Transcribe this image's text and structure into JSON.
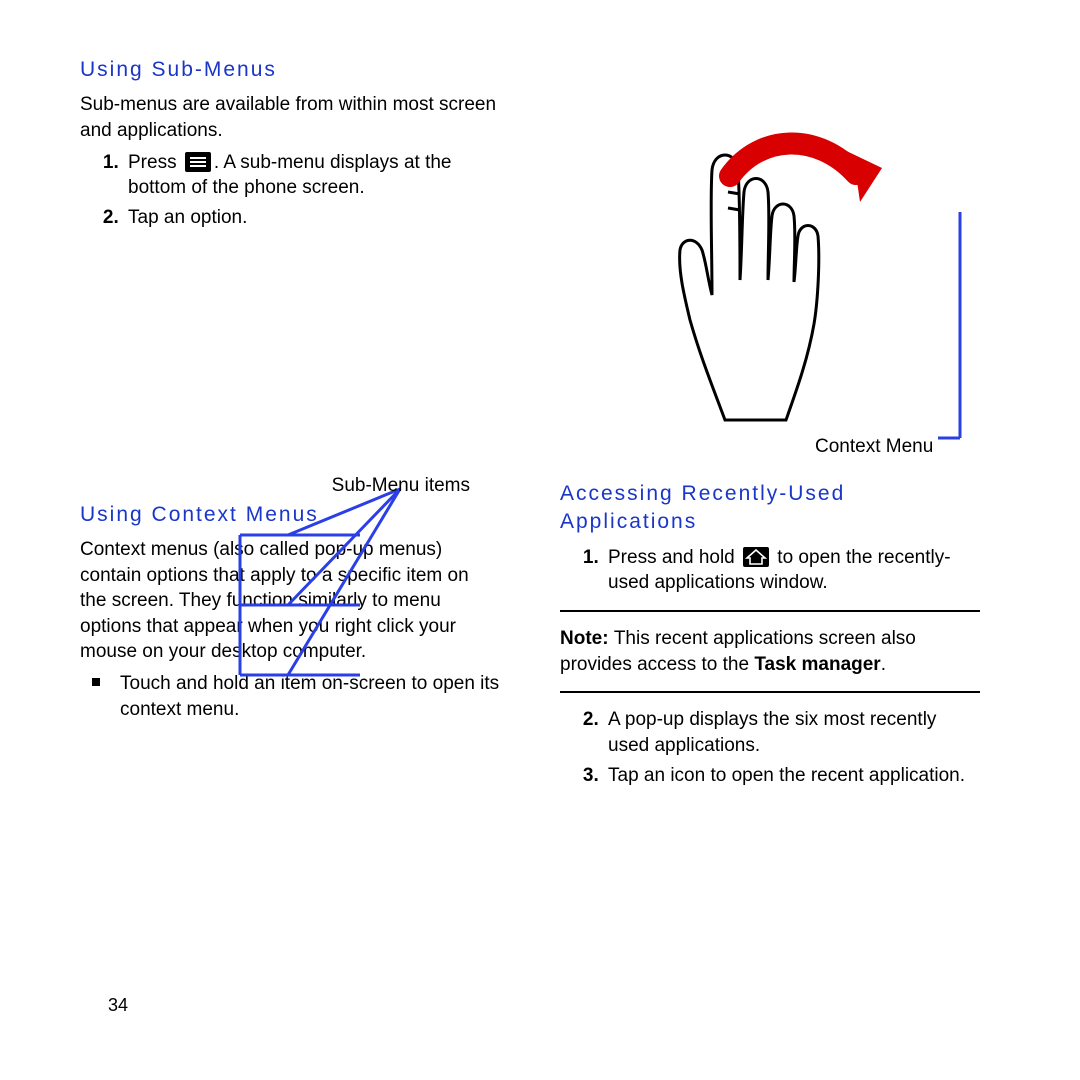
{
  "left": {
    "heading_submenus": "Using Sub-Menus",
    "submenus_intro": "Sub-menus are available from within most screen and applications.",
    "step1_a": "Press ",
    "step1_b": ". A sub-menu displays at the bottom of the phone screen.",
    "step2": "Tap an option.",
    "fig_submenu_label": "Sub-Menu items",
    "heading_context": "Using Context Menus",
    "context_para": "Context menus (also called pop-up menus) contain options that apply to a specific item on the screen. They function similarly to menu options that appear when you right click your mouse on your desktop computer.",
    "context_bullet": "Touch and hold an item on-screen to open its context menu."
  },
  "right": {
    "fig_context_label": "Context Menu",
    "heading_recent": "Accessing Recently-Used Applications",
    "recent_step1_a": "Press and hold ",
    "recent_step1_b": " to open the recently-used applications window.",
    "note_label": "Note: ",
    "note_body": "This recent applications screen also provides access to the ",
    "task_manager": "Task manager",
    "note_tail": ".",
    "recent_step2": "A pop-up displays the six most recently used applications.",
    "recent_step3": "Tap an icon to open the recent application."
  },
  "page_number": "34"
}
